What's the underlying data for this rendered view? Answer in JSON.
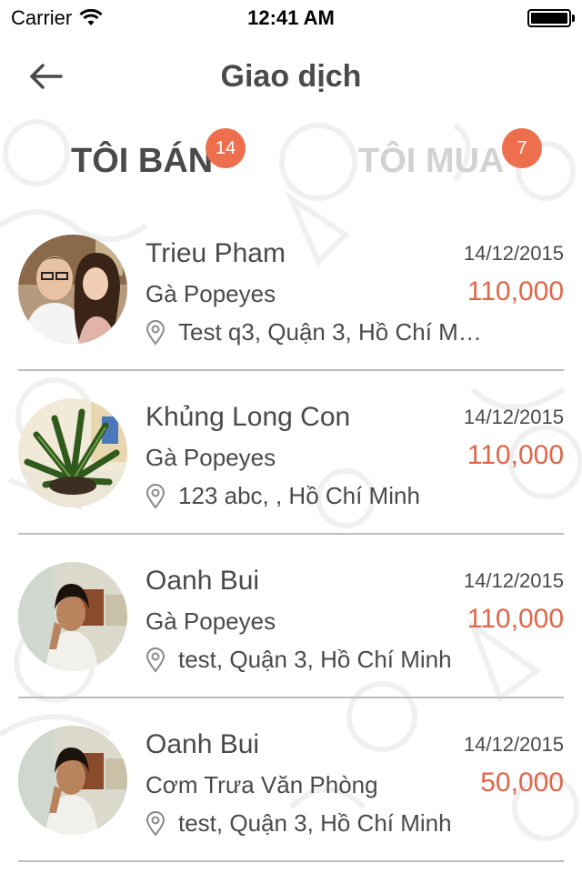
{
  "status_bar": {
    "carrier": "Carrier",
    "time": "12:41 AM",
    "icons": [
      "wifi-icon",
      "battery-icon"
    ]
  },
  "nav": {
    "title": "Giao dịch",
    "back_icon": "arrow-left-icon"
  },
  "tabs": [
    {
      "label": "TÔI BÁN",
      "badge": "14",
      "active": true
    },
    {
      "label": "TÔI MUA",
      "badge": "7",
      "active": false
    }
  ],
  "colors": {
    "accent": "#ee6f4d",
    "price": "#e0664a",
    "text": "#4a4a4a",
    "inactive_tab": "#d2d2d2"
  },
  "transactions": [
    {
      "name": "Trieu Pham",
      "date": "14/12/2015",
      "item": "Gà Popeyes",
      "price": "110,000",
      "address": "Test q3, Quận 3, Hồ Chí M…",
      "avatar": "couple-photo"
    },
    {
      "name": "Khủng Long Con",
      "date": "14/12/2015",
      "item": "Gà Popeyes",
      "price": "110,000",
      "address": "123 abc, , Hồ Chí Minh",
      "avatar": "plant-photo"
    },
    {
      "name": "Oanh Bui",
      "date": "14/12/2015",
      "item": "Gà Popeyes",
      "price": "110,000",
      "address": "test, Quận 3, Hồ Chí Minh",
      "avatar": "girl-photo"
    },
    {
      "name": "Oanh Bui",
      "date": "14/12/2015",
      "item": "Cơm Trưa Văn Phòng",
      "price": "50,000",
      "address": "test, Quận 3, Hồ Chí Minh",
      "avatar": "girl-photo"
    }
  ]
}
